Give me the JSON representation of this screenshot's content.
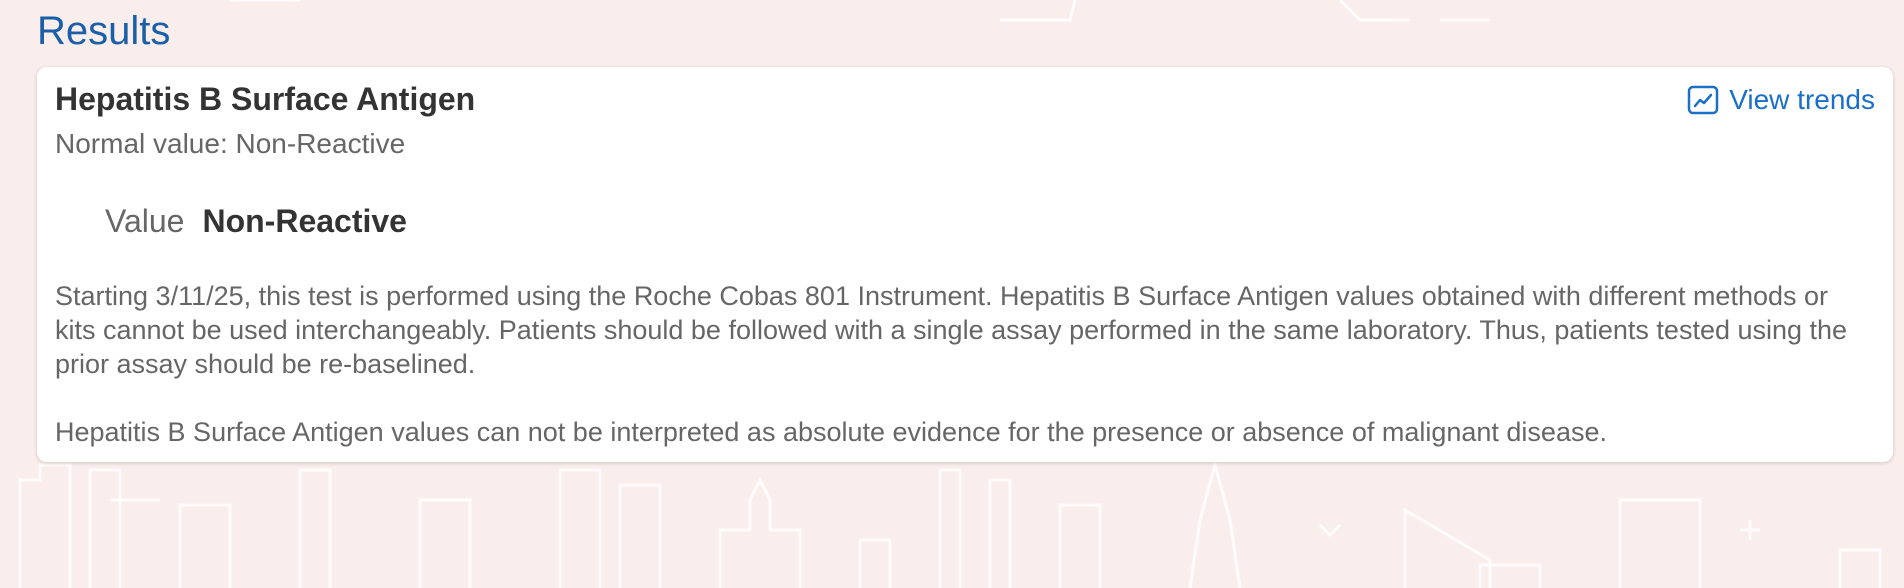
{
  "header": {
    "title": "Results"
  },
  "result": {
    "test_name": "Hepatitis B Surface Antigen",
    "normal_value": "Normal value: Non-Reactive",
    "view_trends_label": "View trends",
    "value_label": "Value",
    "value": "Non-Reactive",
    "notes": [
      "Starting 3/11/25, this test is performed using the Roche Cobas 801 Instrument. Hepatitis B Surface Antigen values obtained with different methods or kits cannot be used interchangeably. Patients should be followed with a single assay performed in the same laboratory. Thus, patients tested using the prior assay should be re-baselined.",
      "Hepatitis B Surface Antigen values can not be interpreted as absolute evidence for the presence or absence of malignant disease."
    ]
  },
  "icons": {
    "trends": "line-chart-icon"
  },
  "colors": {
    "background": "#faeeed",
    "title": "#1a5fa8",
    "link": "#1a6fc9",
    "heading_text": "#333333",
    "body_text": "#666666",
    "card": "#ffffff"
  }
}
